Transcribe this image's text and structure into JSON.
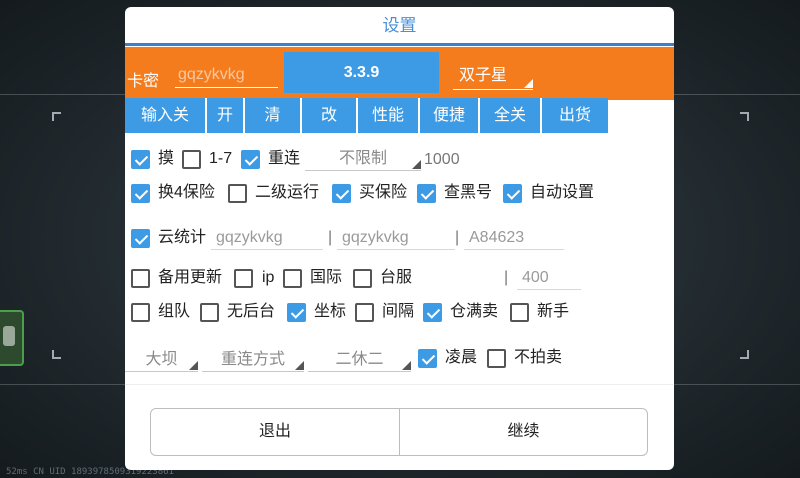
{
  "dialog": {
    "title": "设置"
  },
  "card": {
    "label": "卡密",
    "value": "gqzykvkg"
  },
  "version_button": "3.3.9",
  "star_select": {
    "value": "双子星"
  },
  "toolbar": [
    "输入关",
    "开",
    "清",
    "改",
    "性能",
    "便捷",
    "全关",
    "出货"
  ],
  "row1": {
    "mo": {
      "label": "摸",
      "checked": true
    },
    "range": {
      "label": "1-7",
      "checked": false
    },
    "reconnect": {
      "label": "重连",
      "checked": true
    },
    "limit_select": "不限制",
    "limit_value": "1000"
  },
  "row2": [
    {
      "label": "换4保险",
      "checked": true
    },
    {
      "label": "二级运行",
      "checked": false
    },
    {
      "label": "买保险",
      "checked": true
    },
    {
      "label": "查黑号",
      "checked": true
    },
    {
      "label": "自动设置",
      "checked": true
    }
  ],
  "cloud": {
    "label": "云统计",
    "checked": true,
    "field1": "gqzykvkg",
    "field2": "gqzykvkg",
    "field3": "A84623",
    "separator": "|"
  },
  "row4": {
    "items": [
      {
        "label": "备用更新",
        "checked": false
      },
      {
        "label": "ip",
        "checked": false
      },
      {
        "label": "国际",
        "checked": false
      },
      {
        "label": "台服",
        "checked": false
      }
    ],
    "separator": "|",
    "value": "400"
  },
  "row5": [
    {
      "label": "组队",
      "checked": false
    },
    {
      "label": "无后台",
      "checked": false
    },
    {
      "label": "坐标",
      "checked": true
    },
    {
      "label": "间隔",
      "checked": false
    },
    {
      "label": "仓满卖",
      "checked": true
    },
    {
      "label": "新手",
      "checked": false
    }
  ],
  "row6": {
    "map_select": "大坝",
    "reconnect_mode_select": "重连方式",
    "rest_select": "二休二",
    "dawn": {
      "label": "凌晨",
      "checked": true
    },
    "no_auction": {
      "label": "不拍卖",
      "checked": false
    }
  },
  "actions": {
    "exit": "退出",
    "continue": "继续"
  },
  "background_status": "52ms      CN UID 1893978509319223861"
}
